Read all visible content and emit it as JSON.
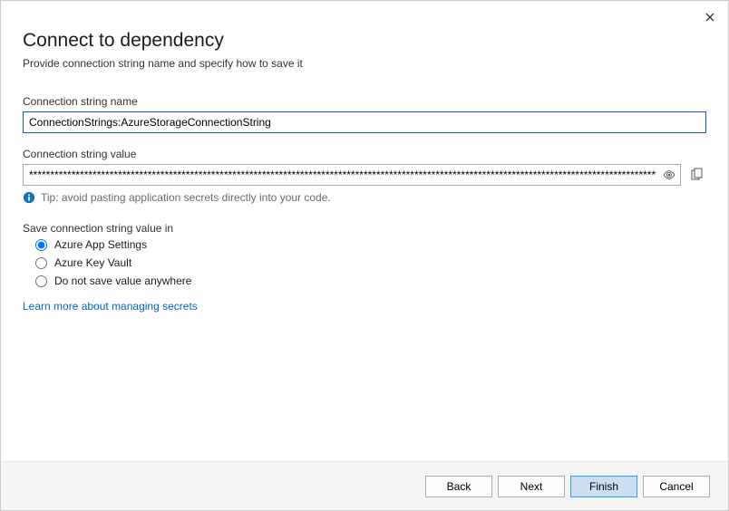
{
  "header": {
    "title": "Connect to dependency",
    "subtitle": "Provide connection string name and specify how to save it"
  },
  "name_field": {
    "label": "Connection string name",
    "value": "ConnectionStrings:AzureStorageConnectionString"
  },
  "value_field": {
    "label": "Connection string value",
    "value": "*******************************************************************************************************************************************************************"
  },
  "tip": "Tip: avoid pasting application secrets directly into your code.",
  "save_section": {
    "label": "Save connection string value in",
    "options": [
      {
        "label": "Azure App Settings",
        "checked": true
      },
      {
        "label": "Azure Key Vault",
        "checked": false
      },
      {
        "label": "Do not save value anywhere",
        "checked": false
      }
    ]
  },
  "link": "Learn more about managing secrets",
  "buttons": {
    "back": "Back",
    "next": "Next",
    "finish": "Finish",
    "cancel": "Cancel"
  }
}
